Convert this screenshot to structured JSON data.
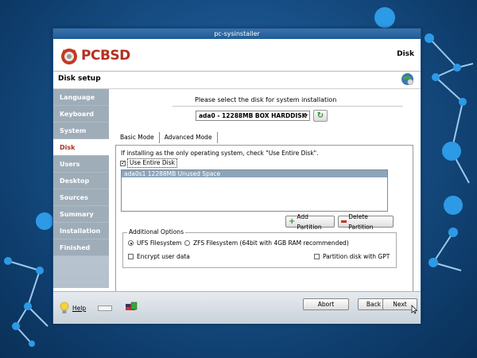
{
  "window": {
    "title": "pc-sysinstaller"
  },
  "header": {
    "logo_pc": "PC",
    "logo_bsd": "BSD",
    "page_label": "Disk"
  },
  "subheader": {
    "title": "Disk setup"
  },
  "sidebar": {
    "items": [
      {
        "label": "Language",
        "active": false
      },
      {
        "label": "Keyboard",
        "active": false
      },
      {
        "label": "System",
        "active": false
      },
      {
        "label": "Disk",
        "active": true
      },
      {
        "label": "Users",
        "active": false
      },
      {
        "label": "Desktop",
        "active": false
      },
      {
        "label": "Sources",
        "active": false
      },
      {
        "label": "Summary",
        "active": false
      },
      {
        "label": "Installation",
        "active": false
      },
      {
        "label": "Finished",
        "active": false
      }
    ]
  },
  "disk": {
    "prompt": "Please select the disk for system installation",
    "selected": "ada0 - 12288MB BOX HARDDISK"
  },
  "tabs": [
    {
      "label": "Basic Mode",
      "active": true
    },
    {
      "label": "Advanced Mode",
      "active": false
    }
  ],
  "basic": {
    "note": "If installing as the only operating system, check \"Use Entire Disk\".",
    "use_entire_label": "Use Entire Disk",
    "use_entire_checked": true,
    "partitions": [
      "ada0s1  12288MB Unused Space"
    ],
    "add_partition": "Add Partition",
    "delete_partition": "Delete Partition"
  },
  "options": {
    "legend": "Additional Options",
    "ufs_label": "UFS Filesystem",
    "zfs_label": "ZFS Filesystem (64bit with 4GB RAM recommended)",
    "encrypt_label": "Encrypt user data",
    "gpt_label": "Partition disk with GPT",
    "ufs_selected": true
  },
  "footer": {
    "help": "Help",
    "abort": "Abort",
    "back": "Back",
    "next": "Next"
  },
  "colors": {
    "accent": "#b5301f",
    "desktop": "#174f86"
  }
}
